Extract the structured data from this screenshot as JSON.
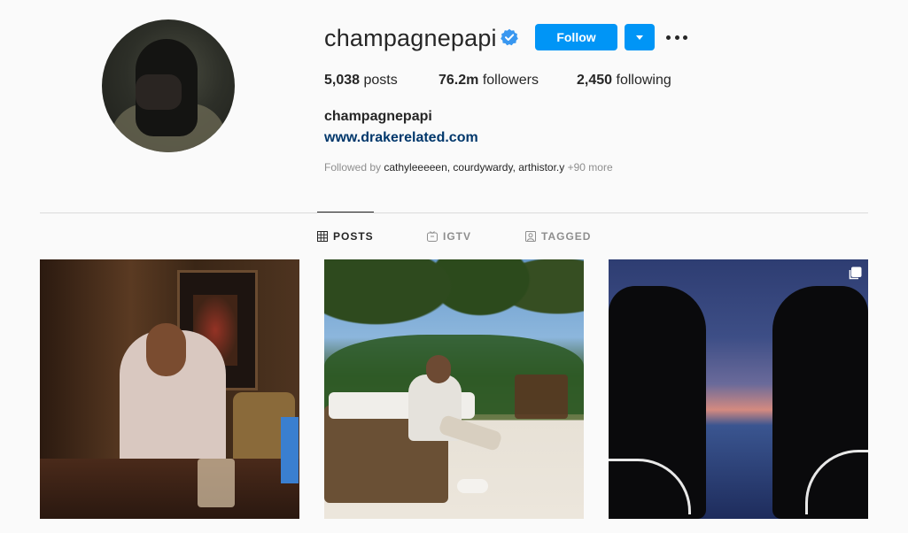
{
  "profile": {
    "username": "champagnepapi",
    "verified": true,
    "full_name": "champagnepapi",
    "website": "www.drakerelated.com",
    "follow_label": "Follow",
    "stats": {
      "posts_count": "5,038",
      "posts_label": "posts",
      "followers_count": "76.2m",
      "followers_label": "followers",
      "following_count": "2,450",
      "following_label": "following"
    },
    "followed_by": {
      "prefix": "Followed by",
      "names": "cathyleeeeen, courdywardy, arthistor.y",
      "more": "+90 more"
    }
  },
  "tabs": [
    {
      "label": "POSTS",
      "icon": "grid-icon",
      "active": true
    },
    {
      "label": "IGTV",
      "icon": "igtv-icon",
      "active": false
    },
    {
      "label": "TAGGED",
      "icon": "tagged-icon",
      "active": false
    }
  ],
  "posts": [
    {
      "description": "studio-photo"
    },
    {
      "description": "beach-photo"
    },
    {
      "description": "dusk-photo",
      "multi": true
    }
  ],
  "colors": {
    "accent": "#0095f6",
    "link": "#00376b",
    "text": "#262626",
    "muted": "#8e8e8e",
    "background": "#fafafa",
    "divider": "#dbdbdb"
  }
}
